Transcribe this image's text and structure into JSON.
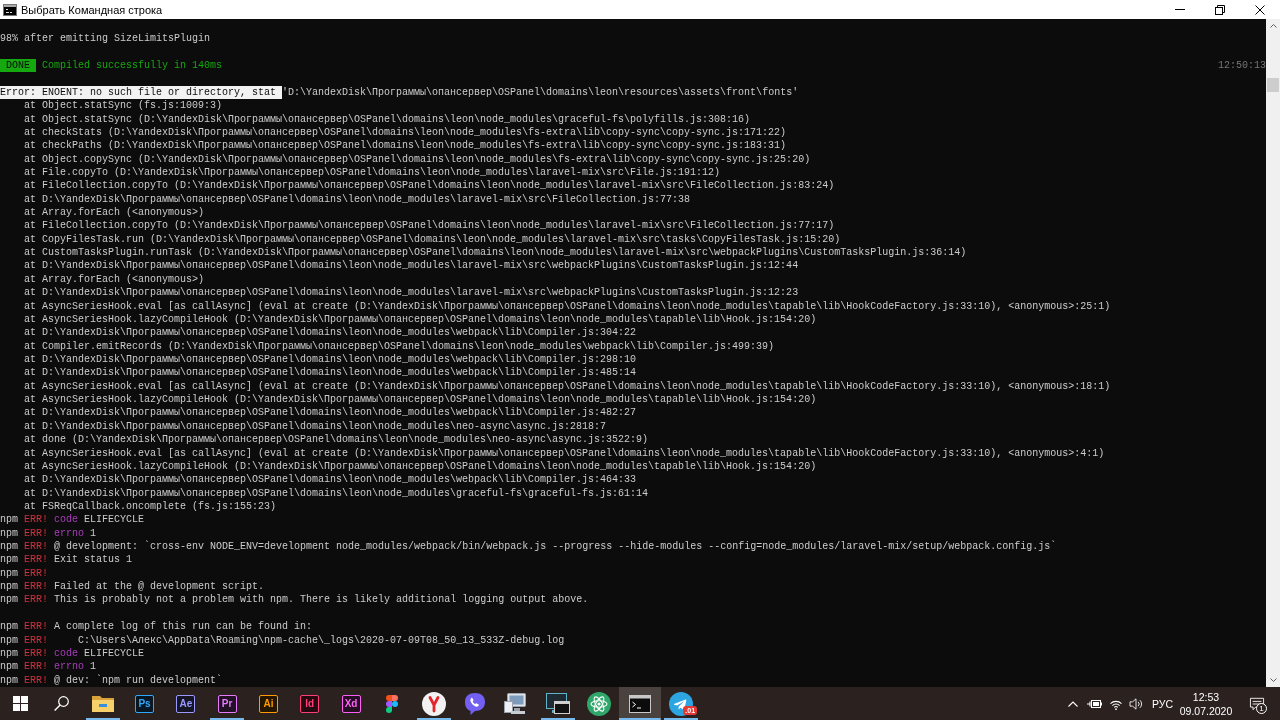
{
  "window": {
    "title": "Выбрать Командная строка"
  },
  "console": {
    "blocks": [
      {
        "lines": [
          {
            "kind": "log",
            "segments": [
              {
                "kind": "plain",
                "text": "98% after emitting SizeLimitsPlugin"
              }
            ]
          }
        ]
      },
      {
        "lines": [
          {
            "kind": "log",
            "segments": [
              {
                "kind": "badge",
                "text": "DONE"
              },
              {
                "kind": "success",
                "text": "Compiled successfully in 140ms"
              },
              {
                "kind": "timestamp",
                "text": "12:50:13"
              }
            ]
          }
        ]
      },
      {
        "lines": [
          {
            "kind": "log",
            "segments": [
              {
                "kind": "selection",
                "text": "Error: ENOENT: no such file or directory, stat"
              },
              {
                "kind": "plain",
                "text": "'D:\\YandexDisk\\Программы\\опансервер\\OSPanel\\domains\\leon\\resources\\assets\\front\\fonts'"
              }
            ]
          },
          {
            "kind": "stack",
            "text": "at Object.statSync (fs.js:1009:3)"
          },
          {
            "kind": "stack",
            "text": "at Object.statSync (D:\\YandexDisk\\Программы\\опансервер\\OSPanel\\domains\\leon\\node_modules\\graceful-fs\\polyfills.js:308:16)"
          },
          {
            "kind": "stack",
            "text": "at checkStats (D:\\YandexDisk\\Программы\\опансервер\\OSPanel\\domains\\leon\\node_modules\\fs-extra\\lib\\copy-sync\\copy-sync.js:171:22)"
          },
          {
            "kind": "stack",
            "text": "at checkPaths (D:\\YandexDisk\\Программы\\опансервер\\OSPanel\\domains\\leon\\node_modules\\fs-extra\\lib\\copy-sync\\copy-sync.js:183:31)"
          },
          {
            "kind": "stack",
            "text": "at Object.copySync (D:\\YandexDisk\\Программы\\опансервер\\OSPanel\\domains\\leon\\node_modules\\fs-extra\\lib\\copy-sync\\copy-sync.js:25:20)"
          },
          {
            "kind": "stack",
            "text": "at File.copyTo (D:\\YandexDisk\\Программы\\опансервер\\OSPanel\\domains\\leon\\node_modules\\laravel-mix\\src\\File.js:191:12)"
          },
          {
            "kind": "stack",
            "text": "at FileCollection.copyTo (D:\\YandexDisk\\Программы\\опансервер\\OSPanel\\domains\\leon\\node_modules\\laravel-mix\\src\\FileCollection.js:83:24)"
          },
          {
            "kind": "stack",
            "text": "at D:\\YandexDisk\\Программы\\опансервер\\OSPanel\\domains\\leon\\node_modules\\laravel-mix\\src\\FileCollection.js:77:38"
          },
          {
            "kind": "stack",
            "text": "at Array.forEach (<anonymous>)"
          },
          {
            "kind": "stack",
            "text": "at FileCollection.copyTo (D:\\YandexDisk\\Программы\\опансервер\\OSPanel\\domains\\leon\\node_modules\\laravel-mix\\src\\FileCollection.js:77:17)"
          },
          {
            "kind": "stack",
            "text": "at CopyFilesTask.run (D:\\YandexDisk\\Программы\\опансервер\\OSPanel\\domains\\leon\\node_modules\\laravel-mix\\src\\tasks\\CopyFilesTask.js:15:20)"
          },
          {
            "kind": "stack",
            "text": "at CustomTasksPlugin.runTask (D:\\YandexDisk\\Программы\\опансервер\\OSPanel\\domains\\leon\\node_modules\\laravel-mix\\src\\webpackPlugins\\CustomTasksPlugin.js:36:14)"
          },
          {
            "kind": "stack",
            "text": "at D:\\YandexDisk\\Программы\\опансервер\\OSPanel\\domains\\leon\\node_modules\\laravel-mix\\src\\webpackPlugins\\CustomTasksPlugin.js:12:44"
          },
          {
            "kind": "stack",
            "text": "at Array.forEach (<anonymous>)"
          },
          {
            "kind": "stack",
            "text": "at D:\\YandexDisk\\Программы\\опансервер\\OSPanel\\domains\\leon\\node_modules\\laravel-mix\\src\\webpackPlugins\\CustomTasksPlugin.js:12:23"
          },
          {
            "kind": "stack",
            "text": "at AsyncSeriesHook.eval [as callAsync] (eval at create (D:\\YandexDisk\\Программы\\опансервер\\OSPanel\\domains\\leon\\node_modules\\tapable\\lib\\HookCodeFactory.js:33:10), <anonymous>:25:1)"
          },
          {
            "kind": "stack",
            "text": "at AsyncSeriesHook.lazyCompileHook (D:\\YandexDisk\\Программы\\опансервер\\OSPanel\\domains\\leon\\node_modules\\tapable\\lib\\Hook.js:154:20)"
          },
          {
            "kind": "stack",
            "text": "at D:\\YandexDisk\\Программы\\опансервер\\OSPanel\\domains\\leon\\node_modules\\webpack\\lib\\Compiler.js:304:22"
          },
          {
            "kind": "stack",
            "text": "at Compiler.emitRecords (D:\\YandexDisk\\Программы\\опансервер\\OSPanel\\domains\\leon\\node_modules\\webpack\\lib\\Compiler.js:499:39)"
          },
          {
            "kind": "stack",
            "text": "at D:\\YandexDisk\\Программы\\опансервер\\OSPanel\\domains\\leon\\node_modules\\webpack\\lib\\Compiler.js:298:10"
          },
          {
            "kind": "stack",
            "text": "at D:\\YandexDisk\\Программы\\опансервер\\OSPanel\\domains\\leon\\node_modules\\webpack\\lib\\Compiler.js:485:14"
          },
          {
            "kind": "stack",
            "text": "at AsyncSeriesHook.eval [as callAsync] (eval at create (D:\\YandexDisk\\Программы\\опансервер\\OSPanel\\domains\\leon\\node_modules\\tapable\\lib\\HookCodeFactory.js:33:10), <anonymous>:18:1)"
          },
          {
            "kind": "stack",
            "text": "at AsyncSeriesHook.lazyCompileHook (D:\\YandexDisk\\Программы\\опансервер\\OSPanel\\domains\\leon\\node_modules\\tapable\\lib\\Hook.js:154:20)"
          },
          {
            "kind": "stack",
            "text": "at D:\\YandexDisk\\Программы\\опансервер\\OSPanel\\domains\\leon\\node_modules\\webpack\\lib\\Compiler.js:482:27"
          },
          {
            "kind": "stack",
            "text": "at D:\\YandexDisk\\Программы\\опансервер\\OSPanel\\domains\\leon\\node_modules\\neo-async\\async.js:2818:7"
          },
          {
            "kind": "stack",
            "text": "at done (D:\\YandexDisk\\Программы\\опансервер\\OSPanel\\domains\\leon\\node_modules\\neo-async\\async.js:3522:9)"
          },
          {
            "kind": "stack",
            "text": "at AsyncSeriesHook.eval [as callAsync] (eval at create (D:\\YandexDisk\\Программы\\опансервер\\OSPanel\\domains\\leon\\node_modules\\tapable\\lib\\HookCodeFactory.js:33:10), <anonymous>:4:1)"
          },
          {
            "kind": "stack",
            "text": "at AsyncSeriesHook.lazyCompileHook (D:\\YandexDisk\\Программы\\опансервер\\OSPanel\\domains\\leon\\node_modules\\tapable\\lib\\Hook.js:154:20)"
          },
          {
            "kind": "stack",
            "text": "at D:\\YandexDisk\\Программы\\опансервер\\OSPanel\\domains\\leon\\node_modules\\webpack\\lib\\Compiler.js:464:33"
          },
          {
            "kind": "stack",
            "text": "at D:\\YandexDisk\\Программы\\опансервер\\OSPanel\\domains\\leon\\node_modules\\graceful-fs\\graceful-fs.js:61:14"
          },
          {
            "kind": "stack",
            "text": "at FSReqCallback.oncomplete (fs.js:155:23)"
          },
          {
            "kind": "log",
            "segments": [
              {
                "kind": "plain",
                "text": "npm"
              },
              {
                "kind": "error",
                "text": "ERR!"
              },
              {
                "kind": "keyword",
                "text": "code"
              },
              {
                "kind": "plain",
                "text": "ELIFECYCLE"
              }
            ]
          },
          {
            "kind": "log",
            "segments": [
              {
                "kind": "plain",
                "text": "npm"
              },
              {
                "kind": "error",
                "text": "ERR!"
              },
              {
                "kind": "keyword",
                "text": "errno"
              },
              {
                "kind": "plain",
                "text": "1"
              }
            ]
          },
          {
            "kind": "log",
            "segments": [
              {
                "kind": "plain",
                "text": "npm"
              },
              {
                "kind": "error",
                "text": "ERR!"
              },
              {
                "kind": "plain",
                "text": "@ development: `cross-env NODE_ENV=development node_modules/webpack/bin/webpack.js --progress --hide-modules --config=node_modules/laravel-mix/setup/webpack.config.js`"
              }
            ]
          },
          {
            "kind": "log",
            "segments": [
              {
                "kind": "plain",
                "text": "npm"
              },
              {
                "kind": "error",
                "text": "ERR!"
              },
              {
                "kind": "plain",
                "text": "Exit status 1"
              }
            ]
          },
          {
            "kind": "log",
            "segments": [
              {
                "kind": "plain",
                "text": "npm"
              },
              {
                "kind": "error",
                "text": "ERR!"
              }
            ]
          },
          {
            "kind": "log",
            "segments": [
              {
                "kind": "plain",
                "text": "npm"
              },
              {
                "kind": "error",
                "text": "ERR!"
              },
              {
                "kind": "plain",
                "text": "Failed at the @ development script."
              }
            ]
          },
          {
            "kind": "log",
            "segments": [
              {
                "kind": "plain",
                "text": "npm"
              },
              {
                "kind": "error",
                "text": "ERR!"
              },
              {
                "kind": "plain",
                "text": "This is probably not a problem with npm. There is likely additional logging output above."
              }
            ]
          }
        ]
      },
      {
        "lines": [
          {
            "kind": "log",
            "segments": [
              {
                "kind": "plain",
                "text": "npm"
              },
              {
                "kind": "error",
                "text": "ERR!"
              },
              {
                "kind": "plain",
                "text": "A complete log of this run can be found in:"
              }
            ]
          },
          {
            "kind": "log",
            "segments": [
              {
                "kind": "plain",
                "text": "npm"
              },
              {
                "kind": "error",
                "text": "ERR!"
              },
              {
                "kind": "plain",
                "text": "    C:\\Users\\Алекс\\AppData\\Roaming\\npm-cache\\_logs\\2020-07-09T08_50_13_533Z-debug.log"
              }
            ]
          },
          {
            "kind": "log",
            "segments": [
              {
                "kind": "plain",
                "text": "npm"
              },
              {
                "kind": "error",
                "text": "ERR!"
              },
              {
                "kind": "keyword",
                "text": "code"
              },
              {
                "kind": "plain",
                "text": "ELIFECYCLE"
              }
            ]
          },
          {
            "kind": "log",
            "segments": [
              {
                "kind": "plain",
                "text": "npm"
              },
              {
                "kind": "error",
                "text": "ERR!"
              },
              {
                "kind": "keyword",
                "text": "errno"
              },
              {
                "kind": "plain",
                "text": "1"
              }
            ]
          },
          {
            "kind": "log",
            "segments": [
              {
                "kind": "plain",
                "text": "npm"
              },
              {
                "kind": "error",
                "text": "ERR!"
              },
              {
                "kind": "plain",
                "text": "@ dev: `npm run development`"
              }
            ]
          }
        ]
      }
    ]
  },
  "taskbar": {
    "apps": [
      {
        "kind": "icon",
        "running": true,
        "selected": false
      },
      {
        "kind": "tile",
        "label": "Ps",
        "color": "#31a8ff",
        "running": false,
        "selected": false
      },
      {
        "kind": "tile",
        "label": "Ae",
        "color": "#9999ff",
        "running": false,
        "selected": false
      },
      {
        "kind": "tile",
        "label": "Pr",
        "color": "#e77bff",
        "running": true,
        "selected": false
      },
      {
        "kind": "tile",
        "label": "Ai",
        "color": "#ff9a00",
        "running": false,
        "selected": false
      },
      {
        "kind": "tile",
        "label": "Id",
        "color": "#ff3d78",
        "running": false,
        "selected": false
      },
      {
        "kind": "tile",
        "label": "Xd",
        "color": "#ff61f6",
        "running": false,
        "selected": false
      },
      {
        "kind": "icon",
        "running": false,
        "selected": false
      },
      {
        "kind": "icon",
        "running": true,
        "selected": false
      },
      {
        "kind": "icon",
        "running": false,
        "selected": false
      },
      {
        "kind": "icon",
        "running": false,
        "selected": false
      },
      {
        "kind": "icon",
        "running": true,
        "selected": false
      },
      {
        "kind": "icon",
        "running": false,
        "selected": false
      },
      {
        "kind": "icon",
        "running": true,
        "selected": true
      },
      {
        "kind": "icon",
        "running": true,
        "selected": false,
        "badge": ".01"
      }
    ],
    "tray": {
      "language": "РУС",
      "time": "12:53",
      "date": "09.07.2020",
      "notification_count": "1"
    }
  }
}
